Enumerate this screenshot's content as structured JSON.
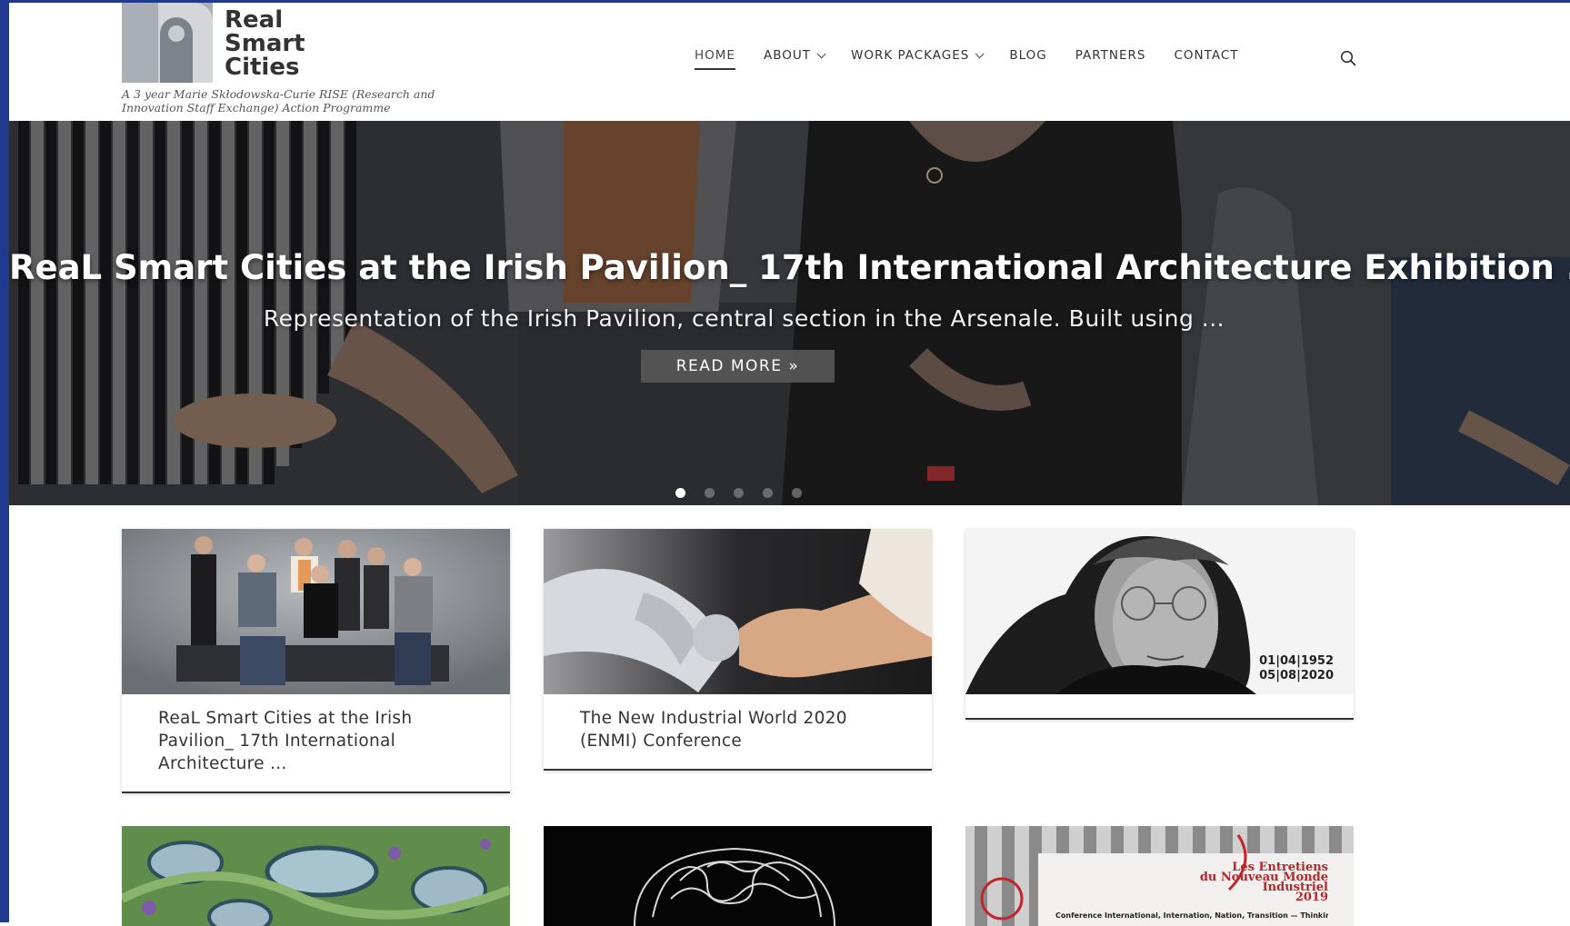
{
  "site": {
    "logo_text": [
      "Real",
      "Smart",
      "Cities"
    ],
    "tagline": "A 3 year Marie Skłodowska-Curie RISE (Research and Innovation Staff Exchange) Action Programme"
  },
  "nav": {
    "items": [
      {
        "label": "HOME",
        "active": true,
        "dropdown": false
      },
      {
        "label": "ABOUT",
        "active": false,
        "dropdown": true
      },
      {
        "label": "WORK PACKAGES",
        "active": false,
        "dropdown": true
      },
      {
        "label": "BLOG",
        "active": false,
        "dropdown": false
      },
      {
        "label": "PARTNERS",
        "active": false,
        "dropdown": false
      },
      {
        "label": "CONTACT",
        "active": false,
        "dropdown": false
      }
    ],
    "search_icon": "search-icon"
  },
  "hero": {
    "title": "ReaL Smart Cities at the Irish Pavilion_ 17th International Architecture Exhibition ...",
    "subtitle": "Representation of the Irish Pavilion, central section in the Arsenale. Built using ...",
    "button_label": "READ MORE »",
    "slide_count": 5,
    "active_slide": 1
  },
  "cards": [
    {
      "title": "ReaL Smart Cities at the Irish Pavilion_ 17th International Architecture ..."
    },
    {
      "title": "The New Industrial World 2020 (ENMI) Conference"
    },
    {
      "title": "",
      "date_lines": [
        "01|04|1952",
        "05|08|2020"
      ]
    }
  ],
  "thumbs": [
    {
      "alt": "green architecture aerial render"
    },
    {
      "alt": "brain line drawing on black"
    },
    {
      "alt": "conference poster",
      "poster_title": [
        "Les Entretiens",
        "du Nouveau Monde",
        "Industriel",
        "2019"
      ],
      "poster_subtitle": "Conference International, Internation, Nation, Transition — Thinking locality in Globalisation"
    }
  ],
  "colors": {
    "frame": "#1f3a8f",
    "text": "#333333",
    "button_bg": "#5a5a5a",
    "poster_red": "#b5262a"
  }
}
